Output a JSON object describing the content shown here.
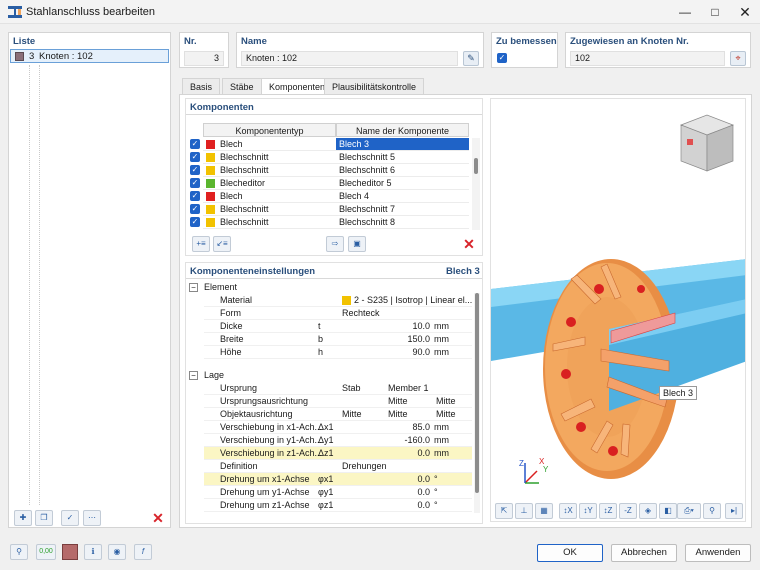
{
  "window": {
    "title": "Stahlanschluss bearbeiten"
  },
  "list": {
    "header": "Liste",
    "items": [
      {
        "number": "3",
        "label": "Knoten : 102",
        "color": "#8a6f7a"
      }
    ]
  },
  "top": {
    "nr_label": "Nr.",
    "nr_value": "3",
    "name_label": "Name",
    "name_value": "Knoten : 102",
    "design_label": "Zu bemessen",
    "design_checked": true,
    "assigned_label": "Zugewiesen an Knoten Nr.",
    "assigned_value": "102"
  },
  "tabs": [
    "Basis",
    "Stäbe",
    "Komponenten",
    "Plausibilitätskontrolle"
  ],
  "active_tab": "Komponenten",
  "components": {
    "header": "Komponenten",
    "col_type": "Komponententyp",
    "col_name": "Name der Komponente",
    "rows": [
      {
        "type": "Blech",
        "name": "Blech 3",
        "color": "#e02020",
        "selected": true
      },
      {
        "type": "Blechschnitt",
        "name": "Blechschnitt 5",
        "color": "#f2c200",
        "selected": false
      },
      {
        "type": "Blechschnitt",
        "name": "Blechschnitt 6",
        "color": "#f2c200",
        "selected": false
      },
      {
        "type": "Blecheditor",
        "name": "Blecheditor 5",
        "color": "#5ab52e",
        "selected": false
      },
      {
        "type": "Blech",
        "name": "Blech 4",
        "color": "#e02020",
        "selected": false
      },
      {
        "type": "Blechschnitt",
        "name": "Blechschnitt 7",
        "color": "#f2c200",
        "selected": false
      },
      {
        "type": "Blechschnitt",
        "name": "Blechschnitt 8",
        "color": "#f2c200",
        "selected": false
      }
    ]
  },
  "settings": {
    "header": "Komponenteneinstellungen",
    "header_right": "Blech 3",
    "groups": [
      {
        "title": "Element",
        "rows": [
          {
            "label": "Material",
            "sym": "",
            "value": "2 - S235 | Isotrop | Linear el...",
            "unit": "",
            "swatch": "#f2c200"
          },
          {
            "label": "Form",
            "sym": "",
            "value": "Rechteck",
            "unit": ""
          },
          {
            "label": "Dicke",
            "sym": "t",
            "value": "10.0",
            "unit": "mm"
          },
          {
            "label": "Breite",
            "sym": "b",
            "value": "150.0",
            "unit": "mm"
          },
          {
            "label": "Höhe",
            "sym": "h",
            "value": "90.0",
            "unit": "mm"
          }
        ]
      },
      {
        "title": "Lage",
        "rows": [
          {
            "label": "Ursprung",
            "sym": "",
            "v1": "Stab",
            "v2": "Member 1",
            "v3": ""
          },
          {
            "label": "Ursprungsausrichtung",
            "sym": "",
            "v1": "",
            "v2": "Mitte",
            "v3": "Mitte"
          },
          {
            "label": "Objektausrichtung",
            "sym": "",
            "v1": "Mitte",
            "v2": "Mitte",
            "v3": "Mitte"
          },
          {
            "label": "Verschiebung in x1-Ach...",
            "sym": "Δx1",
            "value": "85.0",
            "unit": "mm"
          },
          {
            "label": "Verschiebung in y1-Ach...",
            "sym": "Δy1",
            "value": "-160.0",
            "unit": "mm"
          },
          {
            "label": "Verschiebung in z1-Ach...",
            "sym": "Δz1",
            "value": "0.0",
            "unit": "mm",
            "highlight": true
          },
          {
            "label": "Definition",
            "sym": "",
            "v1": "Drehungen",
            "v2": "",
            "v3": ""
          },
          {
            "label": "Drehung um x1-Achse",
            "sym": "φx1",
            "value": "0.0",
            "unit": "°",
            "highlight": true
          },
          {
            "label": "Drehung um y1-Achse",
            "sym": "φy1",
            "value": "0.0",
            "unit": "°"
          },
          {
            "label": "Drehung um z1-Achse",
            "sym": "φz1",
            "value": "0.0",
            "unit": "°"
          }
        ]
      }
    ]
  },
  "viewport": {
    "label": "Blech 3",
    "axis_x": "X",
    "axis_y": "Y",
    "axis_z": "Z"
  },
  "buttons": {
    "ok": "OK",
    "cancel": "Abbrechen",
    "apply": "Anwenden"
  },
  "colors": {
    "accent": "#1f63c7",
    "header": "#2a4f7c",
    "selection": "#1f63c7",
    "highlight": "#fbf6c4",
    "pipe": "#63c6ec",
    "plate": "#f0a35a",
    "stiffener": "#e87a55"
  }
}
